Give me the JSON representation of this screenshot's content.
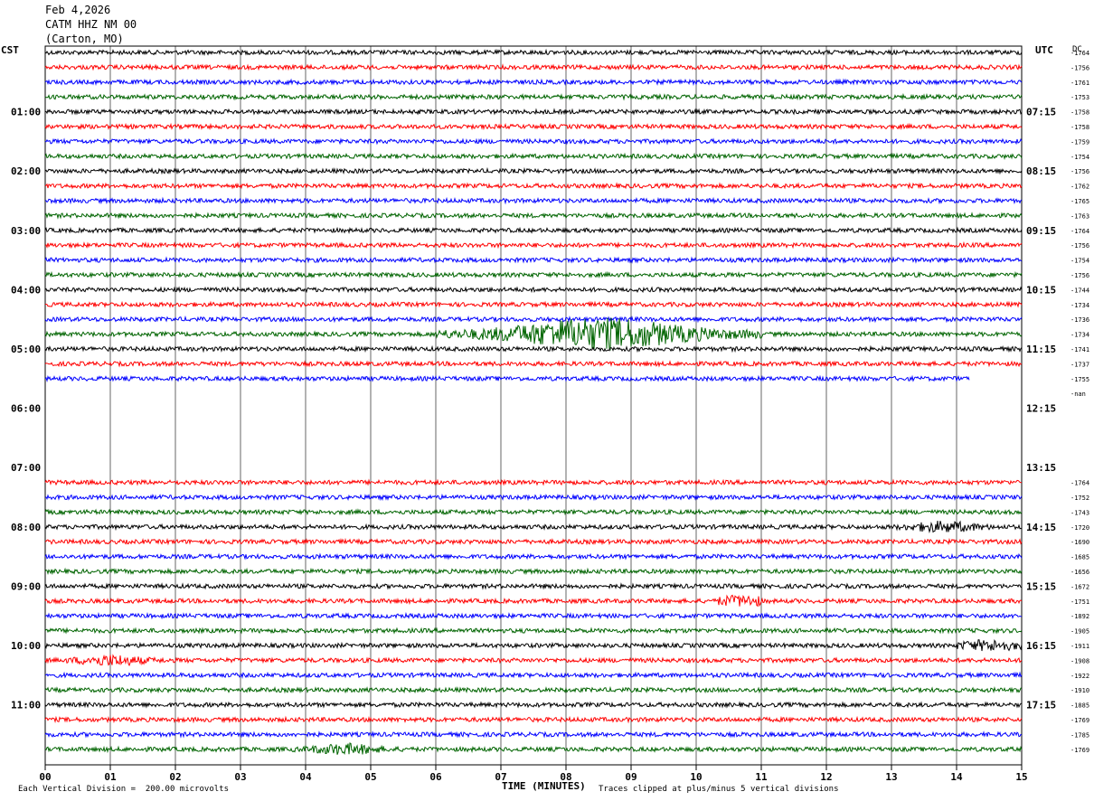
{
  "header": {
    "date": "Feb 4,2026",
    "station": "CATM HHZ NM 00",
    "location": "(Carton, MO)"
  },
  "left_tz": "CST",
  "right_tz": "UTC",
  "dc_label": "DC",
  "footer": {
    "left": "Each Vertical Division =  200.00 microvolts",
    "center": "TIME (MINUTES)",
    "right": "Traces clipped at plus/minus 5 vertical divisions"
  },
  "colors": [
    "#000000",
    "#ff0000",
    "#0000ff",
    "#006400"
  ],
  "chart_data": {
    "type": "line",
    "title": "",
    "xlabel": "TIME (MINUTES)",
    "xlim": [
      0,
      15
    ],
    "x_ticks": [
      "00",
      "01",
      "02",
      "03",
      "04",
      "05",
      "06",
      "07",
      "08",
      "09",
      "10",
      "11",
      "12",
      "13",
      "14",
      "15"
    ],
    "minutes_per_line": 15,
    "left_hour_labels": [
      "01:00",
      "02:00",
      "03:00",
      "04:00",
      "05:00",
      "06:00",
      "07:00",
      "08:00",
      "09:00",
      "10:00",
      "11:00"
    ],
    "right_hour_labels": [
      "07:15",
      "08:15",
      "09:15",
      "10:15",
      "11:15",
      "12:15",
      "13:15",
      "14:15",
      "15:15",
      "16:15",
      "17:15"
    ],
    "dc_offsets": [
      "-1764",
      "-1756",
      "-1761",
      "-1753",
      "-1758",
      "-1758",
      "-1759",
      "-1754",
      "-1756",
      "-1762",
      "-1765",
      "-1763",
      "-1764",
      "-1756",
      "-1754",
      "-1756",
      "-1744",
      "-1734",
      "-1736",
      "-1734",
      "-1741",
      "-1737",
      "-1755",
      "-nan",
      "",
      "",
      "",
      "",
      "",
      "-1764",
      "-1752",
      "-1743",
      "-1720",
      "-1690",
      "-1685",
      "-1656",
      "-1672",
      "-1751",
      "-1892",
      "-1905",
      "-1911",
      "-1908",
      "-1922",
      "-1910",
      "-1885",
      "-1769",
      "-1785",
      "-1769"
    ],
    "trace_extent_minutes": [
      15,
      15,
      15,
      15,
      15,
      15,
      15,
      15,
      15,
      15,
      15,
      15,
      15,
      15,
      15,
      15,
      15,
      15,
      15,
      15,
      15,
      15,
      14.2,
      0,
      0,
      0,
      0,
      0,
      0,
      15,
      15,
      15,
      15,
      15,
      15,
      15,
      15,
      15,
      15,
      15,
      15,
      15,
      15,
      15,
      15,
      15,
      15,
      15
    ],
    "events": [
      {
        "line": 19,
        "start_min": 6.0,
        "end_min": 11.0,
        "peak_min": 8.5,
        "type": "earthquake"
      },
      {
        "line": 32,
        "start_min": 13.0,
        "end_min": 15.0,
        "peak_min": 13.8,
        "type": "burst"
      },
      {
        "line": 40,
        "start_min": 14.0,
        "end_min": 15.0,
        "peak_min": 14.5,
        "type": "burst"
      },
      {
        "line": 41,
        "start_min": 0.3,
        "end_min": 2.2,
        "peak_min": 1.0,
        "type": "burst"
      },
      {
        "line": 37,
        "start_min": 10.3,
        "end_min": 11.0,
        "peak_min": 10.7,
        "type": "burst"
      },
      {
        "line": 47,
        "start_min": 3.8,
        "end_min": 5.6,
        "peak_min": 4.6,
        "type": "burst"
      }
    ]
  }
}
